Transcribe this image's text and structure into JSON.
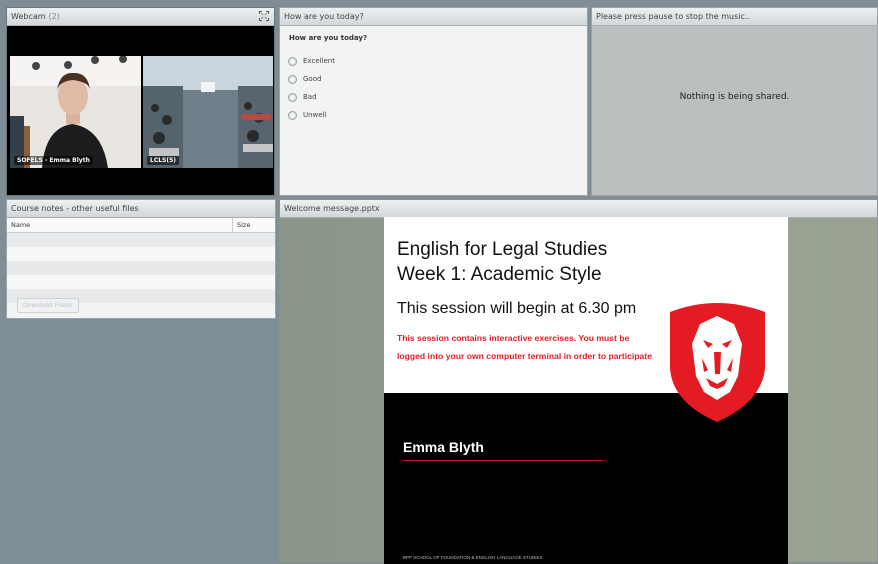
{
  "webcam": {
    "title": "Webcam",
    "count": "(2)",
    "streams": [
      {
        "label": "SOFELS - Emma Blyth"
      },
      {
        "label": "LCLS(5)"
      }
    ]
  },
  "poll": {
    "title": "How are you today?",
    "question": "How are you today?",
    "options": [
      "Excellent",
      "Good",
      "Bad",
      "Unwell"
    ]
  },
  "share": {
    "title": "Please press pause to stop the music..",
    "message": "Nothing is being shared."
  },
  "files": {
    "title": "Course notes - other useful files",
    "columns": [
      "Name",
      "Size"
    ],
    "download_label": "Download File(s)"
  },
  "slides": {
    "title": "Welcome message.pptx",
    "heading_line1": "English for Legal Studies",
    "heading_line2": "Week 1: Academic Style",
    "session_time": "This session will begin at 6.30 pm",
    "note": "This session contains interactive exercises. You must be logged into your own computer terminal in order to participate",
    "presenter": "Emma Blyth",
    "footer": "BPP SCHOOL OF FOUNDATION & ENGLISH LANGUAGE STUDIES"
  },
  "colors": {
    "brand_red": "#e51b24",
    "workspace_bg": "#7f8d96"
  },
  "icons": {
    "fullscreen": "fullscreen-icon",
    "logo": "lion-shield-logo"
  }
}
